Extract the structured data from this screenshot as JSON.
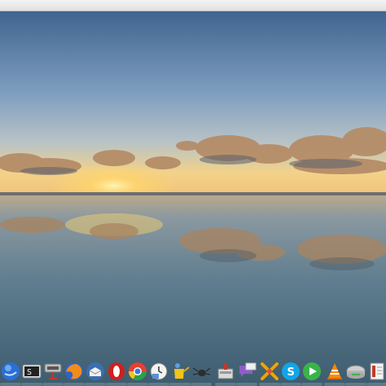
{
  "desktop": {
    "wallpaper_name": "coastal-sunset-reflection",
    "colors": {
      "sky_top": "#3f648f",
      "sky_mid": "#7f9fc0",
      "sky_horizon": "#f3d28a",
      "sun": "#ffd56a",
      "water_top": "#7c8e98",
      "water_bottom": "#3e5e71",
      "cloud": "#b7906b",
      "cloud_dark": "#4f5664"
    }
  },
  "dock": {
    "items": [
      {
        "icon": "blue-globe-icon"
      },
      {
        "icon": "terminal-icon"
      },
      {
        "icon": "network-tools-icon"
      },
      {
        "icon": "firefox-icon"
      },
      {
        "icon": "thunderbird-icon"
      },
      {
        "icon": "opera-icon"
      },
      {
        "icon": "chrome-icon"
      },
      {
        "icon": "clock-app-icon"
      },
      {
        "icon": "watering-can-icon"
      },
      {
        "icon": "spider-icon"
      },
      {
        "icon": "install-package-icon"
      },
      {
        "icon": "chat-icon"
      },
      {
        "icon": "cross-tools-icon"
      },
      {
        "icon": "skype-icon"
      },
      {
        "icon": "media-player-icon"
      },
      {
        "icon": "vlc-icon"
      },
      {
        "icon": "drive-icon"
      },
      {
        "icon": "document-icon"
      }
    ]
  }
}
